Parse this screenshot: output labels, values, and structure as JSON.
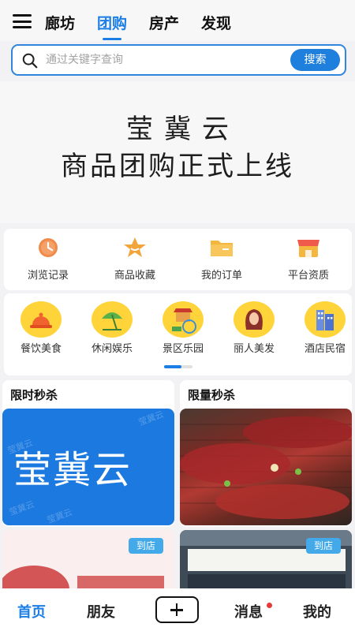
{
  "nav": {
    "tabs": [
      {
        "label": "廊坊"
      },
      {
        "label": "团购"
      },
      {
        "label": "房产"
      },
      {
        "label": "发现"
      }
    ],
    "active_tab": "团购"
  },
  "search": {
    "placeholder": "通过关键字查询",
    "button_label": "搜索"
  },
  "banner": {
    "line1": "莹冀云",
    "line2": "商品团购正式上线"
  },
  "quick_links": [
    {
      "label": "浏览记录",
      "icon": "history-icon"
    },
    {
      "label": "商品收藏",
      "icon": "favorite-icon"
    },
    {
      "label": "我的订单",
      "icon": "order-folder-icon"
    },
    {
      "label": "平台资质",
      "icon": "storefront-icon"
    }
  ],
  "categories": [
    {
      "label": "餐饮美食",
      "icon": "food-cloche-icon"
    },
    {
      "label": "休闲娱乐",
      "icon": "leisure-umbrella-icon"
    },
    {
      "label": "景区乐园",
      "icon": "park-icon"
    },
    {
      "label": "丽人美发",
      "icon": "beauty-hair-icon"
    },
    {
      "label": "酒店民宿",
      "icon": "hotel-icon"
    }
  ],
  "promos": {
    "flash_sale": {
      "title": "限时秒杀",
      "image_text": "莹冀云",
      "watermark": "莹冀云"
    },
    "limited_sale": {
      "title": "限量秒杀"
    }
  },
  "shop_tag": "到店",
  "bottom_nav": [
    {
      "label": "首页"
    },
    {
      "label": "朋友"
    },
    {
      "label": "消息"
    },
    {
      "label": "我的"
    }
  ],
  "colors": {
    "accent": "#1a7ee5",
    "category_icon_bg": "#ffd43b",
    "badge_dot": "#e53a3a"
  }
}
